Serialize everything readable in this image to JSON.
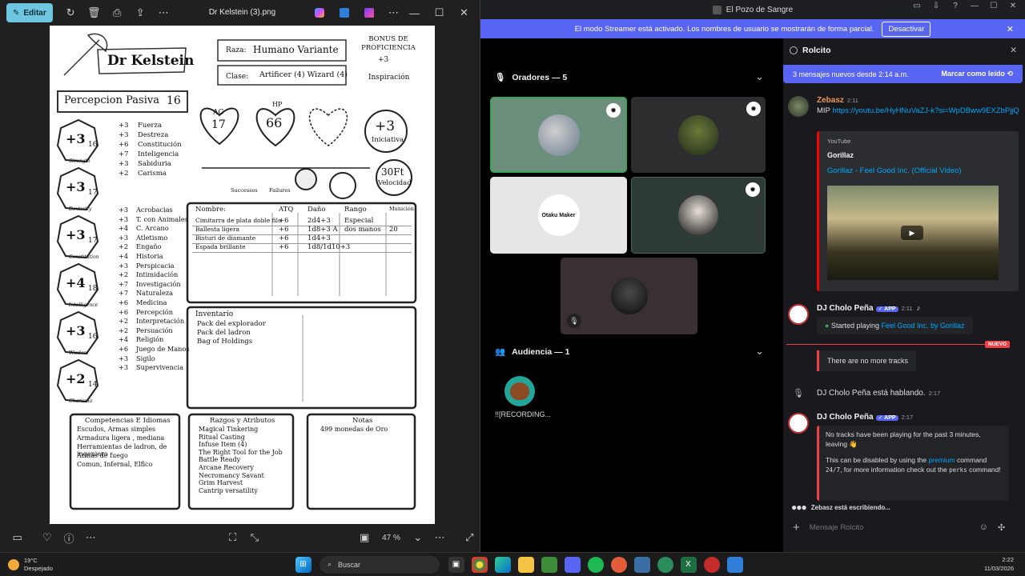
{
  "photos": {
    "edit_label": "Editar",
    "file_title": "Dr Kelstein (3).png",
    "zoom": "47 %"
  },
  "sheet": {
    "name": "Dr Kelstein",
    "race_label": "Raza:",
    "race": "Humano Variante",
    "class_label": "Clase:",
    "class": "Artificer (4) Wizard (4)",
    "bonus_label": "BONUS DE PROFICIENCIA",
    "bonus": "+3",
    "inspiration": "Inspiración",
    "passive_label": "Percepcion Pasiva",
    "passive": "16",
    "ac_label": "AC",
    "ac": "17",
    "hp_label": "HP",
    "hp": "66",
    "initiative": "+3",
    "initiative_label": "Iniciativa",
    "speed": "30Ft",
    "speed_label": "Velocidad",
    "successes": "Successes",
    "failures": "Failures",
    "abilities": [
      {
        "mod": "+3",
        "score": "16",
        "name": "Strength"
      },
      {
        "mod": "+3",
        "score": "17",
        "name": "Dexterity"
      },
      {
        "mod": "+3",
        "score": "17",
        "name": "Constitution"
      },
      {
        "mod": "+4",
        "score": "18",
        "name": "Intelligence"
      },
      {
        "mod": "+3",
        "score": "16",
        "name": "Wisdom"
      },
      {
        "mod": "+2",
        "score": "14",
        "name": "Charisma"
      }
    ],
    "saves": [
      {
        "v": "+3",
        "n": "Fuerza"
      },
      {
        "v": "+3",
        "n": "Destreza"
      },
      {
        "v": "+6",
        "n": "Constitución"
      },
      {
        "v": "+7",
        "n": "Inteligencia"
      },
      {
        "v": "+3",
        "n": "Sabiduria"
      },
      {
        "v": "+2",
        "n": "Carisma"
      }
    ],
    "skills": [
      {
        "v": "+3",
        "n": "Acrobacias"
      },
      {
        "v": "+3",
        "n": "T. con Animales"
      },
      {
        "v": "+4",
        "n": "C. Arcano"
      },
      {
        "v": "+3",
        "n": "Atletismo"
      },
      {
        "v": "+2",
        "n": "Engaño"
      },
      {
        "v": "+4",
        "n": "Historia"
      },
      {
        "v": "+3",
        "n": "Perspicacia"
      },
      {
        "v": "+2",
        "n": "Intimidación"
      },
      {
        "v": "+7",
        "n": "Investigación"
      },
      {
        "v": "+7",
        "n": "Naturaleza"
      },
      {
        "v": "+6",
        "n": "Medicina"
      },
      {
        "v": "+6",
        "n": "Percepción"
      },
      {
        "v": "+2",
        "n": "Interpretación"
      },
      {
        "v": "+2",
        "n": "Persuación"
      },
      {
        "v": "+4",
        "n": "Religión"
      },
      {
        "v": "+6",
        "n": "Juego de Manos"
      },
      {
        "v": "+3",
        "n": "Sigilo"
      },
      {
        "v": "+3",
        "n": "Supervivencia"
      }
    ],
    "attacks_headers": [
      "Nombre:",
      "ATQ",
      "Daño",
      "Rango",
      "Munición"
    ],
    "attacks": [
      [
        "Cimitarra de plata doble filo",
        "+6",
        "2d4+3",
        "Especial",
        ""
      ],
      [
        "Ballesta ligera",
        "+6",
        "1d8+3 A",
        "dos manos",
        "20"
      ],
      [
        "Bisturi de diamante",
        "+6",
        "1d4+3",
        "",
        ""
      ],
      [
        "Espada brillante",
        "+6",
        "1d8/1d10+3",
        "",
        ""
      ]
    ],
    "inventory_title": "Inventario",
    "inventory": [
      "Pack del explorador",
      "Pack del ladron",
      "Bag of Holdings"
    ],
    "prof_title": "Competencias E Idiomas",
    "prof": [
      "Escudos, Armas simples",
      "Armadura ligera , mediana",
      "Herramientas de ladron, de ingeniero",
      "Armas de fuego",
      "Comun, Infernal, Elfico"
    ],
    "traits_title": "Razgos y Atributos",
    "traits": [
      "Magical Tinkering",
      "Ritual Casting",
      "Infuse Item (4)",
      "The Right Tool for the Job",
      "Battle Ready",
      "Arcane Recovery",
      "Necromancy Savant",
      "Grim Harvest",
      "Cantrip versatility"
    ],
    "notes_title": "Notas",
    "notes": [
      "499 monedas de Oro"
    ]
  },
  "discord": {
    "window_title": "El Pozo de Sangre",
    "streamer_text": "El modo Streamer está activado. Los nombres de usuario se mostrarán de forma parcial.",
    "streamer_button": "Desactivar",
    "speakers_label": "Oradores — 5",
    "audience_label": "Audiencia — 1",
    "audience_user": "!![RECORDING...",
    "otaku_text": "Otaku Maker",
    "chat_title": "Rolcito",
    "new_msgs": "3 mensajes nuevos desde 2:14 a.m.",
    "mark_read": "Marcar como leído",
    "messages": {
      "m1_user": "Zebasz",
      "m1_time": "2:11",
      "m1_prefix": "MIP ",
      "m1_link": "https://youtu.be/HyHNuVaZJ-k?si=WpDBww9EXZbPjjQ",
      "embed_site": "YouTube",
      "embed_author": "Gorillaz",
      "embed_title": "Gorillaz - Feel Good Inc. (Official Video)",
      "m2_user": "DJ Cholo Peña",
      "m2_badge": "APP",
      "m2_time": "2:11",
      "m2_playing": "Started playing ",
      "m2_song": "Feel Good Inc. by Gorillaz",
      "nuevo": "NUEVO",
      "m3_text": "There are no more tracks",
      "m4_text": "DJ Cholo Peña está hablando.",
      "m4_time": "2:17",
      "m5_user": "DJ Cholo Peña",
      "m5_badge": "APP",
      "m5_time": "2:17",
      "m5_line1": "No tracks have been playing for the past 3 minutes, leaving",
      "m5_l2a": "This can be disabled by using the ",
      "m5_premium": "premium",
      "m5_l2b": " command ",
      "m5_code1": "24/7",
      "m5_l2c": ", for more information check out the ",
      "m5_code2": "perks",
      "m5_l2d": " command!",
      "typing": "Zebasz está escribiendo..."
    },
    "input_placeholder": "Mensaje Rolcito"
  },
  "taskbar": {
    "temp": "19°C",
    "weather": "Despejado",
    "search": "Buscar",
    "time": "2:22",
    "date": "11/03/2026"
  }
}
